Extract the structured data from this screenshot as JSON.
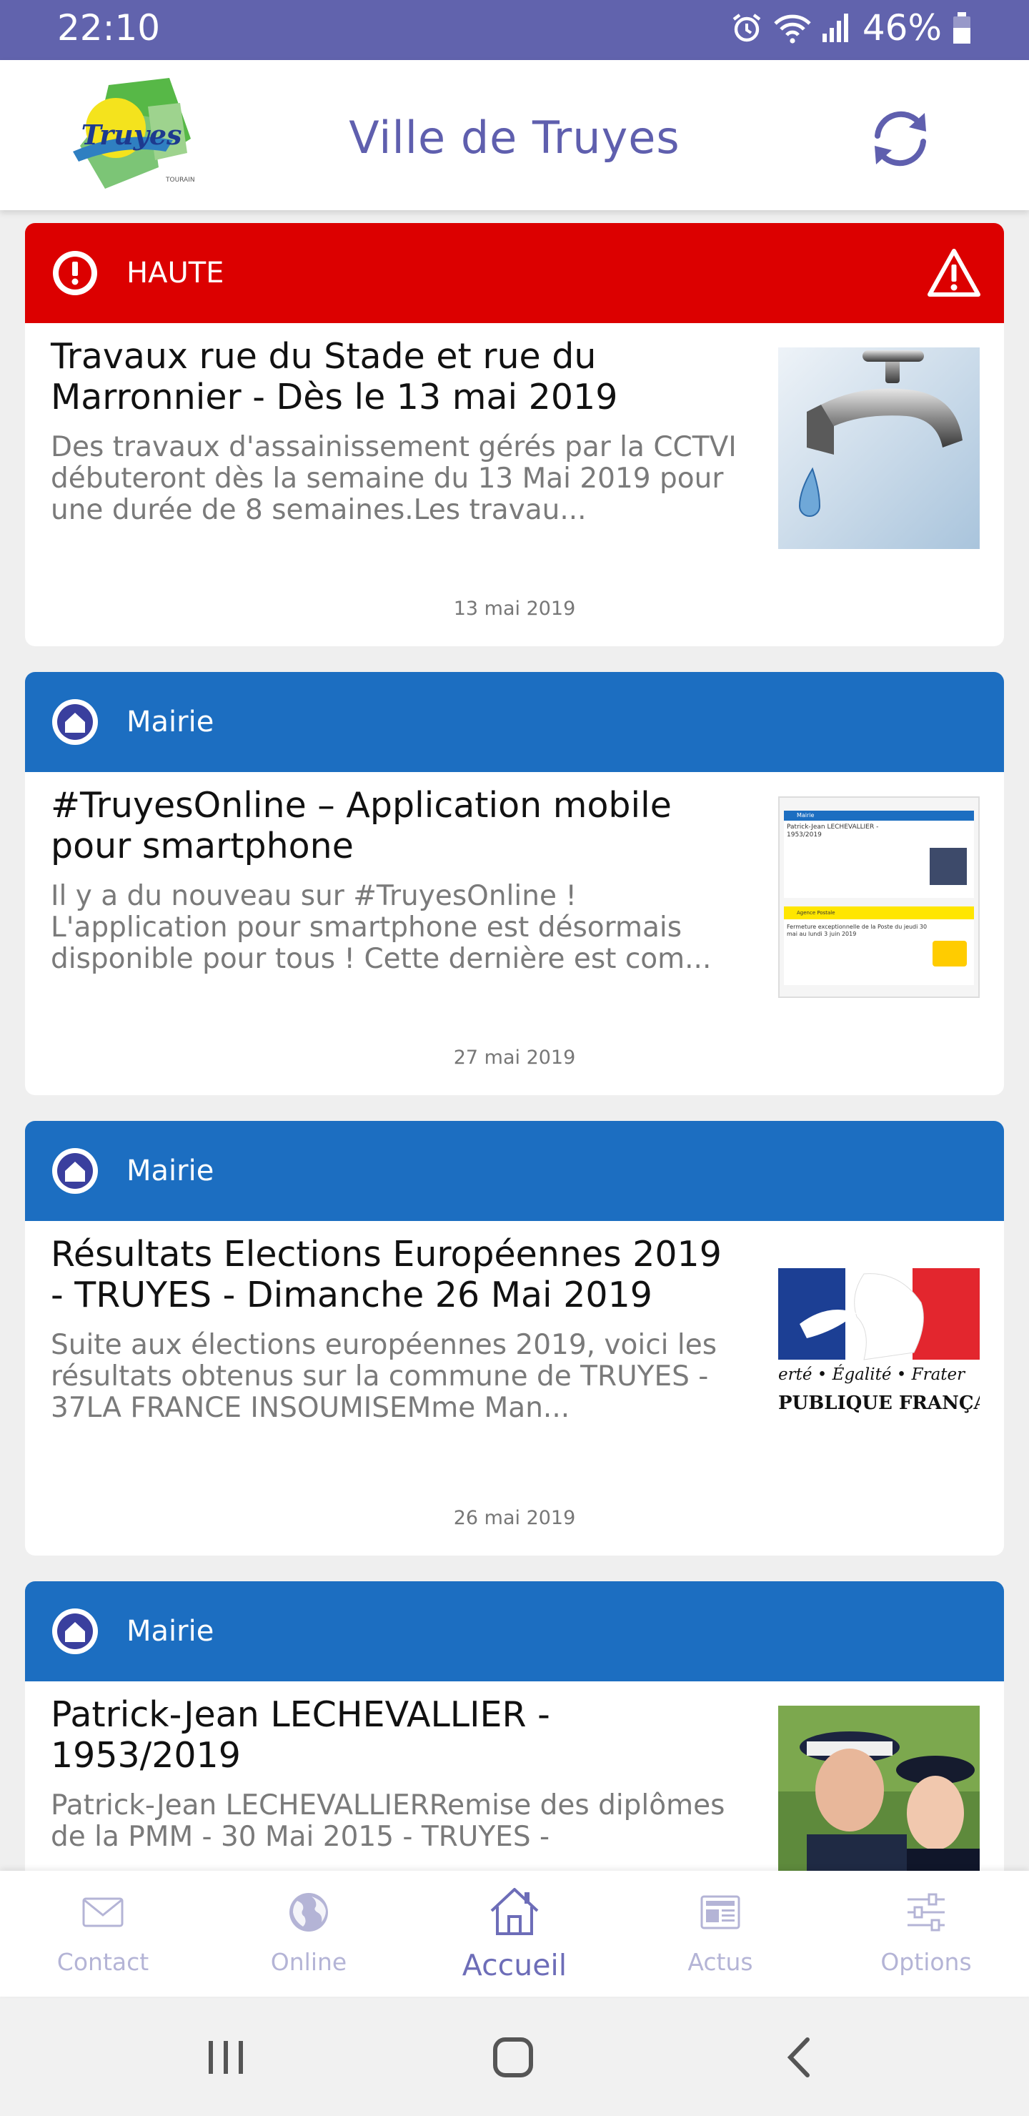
{
  "status_bar": {
    "time": "22:10",
    "battery": "46%"
  },
  "header": {
    "title": "Ville de Truyes",
    "logo_text": "Truyes",
    "logo_subtext": "TOURAINE"
  },
  "colors": {
    "brand": "#6163ad",
    "haute": "#dc0000",
    "mairie": "#1c6ec1"
  },
  "articles": [
    {
      "category": "HAUTE",
      "category_icon": "alert-icon",
      "title": "Travaux rue du Stade et rue du Marronnier - Dès le 13 mai 2019",
      "excerpt": "Des travaux d'assainissement gérés par la CCTVI débuteront dès la semaine du 13 Mai 2019 pour une durée de 8 semaines.Les travau...",
      "date": "13 mai 2019",
      "thumbnail": "water-tap-image"
    },
    {
      "category": "Mairie",
      "category_icon": "home-icon",
      "title": "#TruyesOnline – Application mobile pour smartphone",
      "excerpt": "Il y a du nouveau sur #TruyesOnline ! L'application pour smartphone est désormais disponible pour tous ! Cette dernière est com...",
      "date": "27 mai 2019",
      "thumbnail": "app-screenshot-image",
      "thumb_texts": {
        "mairie_tag": "Mairie",
        "name": "Patrick-Jean LECHEVALLIER - 1953/2019",
        "poste_tag": "Agence Postale",
        "notice": "Fermeture exceptionnelle de la Poste du jeudi 30 mai au lundi 3 juin 2019"
      }
    },
    {
      "category": "Mairie",
      "category_icon": "home-icon",
      "title": "Résultats Elections Européennes 2019 - TRUYES - Dimanche 26 Mai 2019",
      "excerpt": "Suite aux élections européennes 2019, voici les résultats obtenus sur la commune de TRUYES - 37LA FRANCE INSOUMISEMme Man...",
      "date": "26 mai 2019",
      "thumbnail": "republique-francaise-logo",
      "thumb_texts": {
        "motto": "erté • Égalité • Frater",
        "name": "PUBLIQUE FRANÇA"
      }
    },
    {
      "category": "Mairie",
      "category_icon": "home-icon",
      "title": "Patrick-Jean LECHEVALLIER - 1953/2019",
      "excerpt": "Patrick-Jean LECHEVALLIERRemise des diplômes de la PMM - 30 Mai 2015 - TRUYES -",
      "date": "",
      "thumbnail": "navy-officers-photo"
    }
  ],
  "bottom_nav": [
    {
      "label": "Contact",
      "icon": "mail-icon"
    },
    {
      "label": "Online",
      "icon": "globe-icon"
    },
    {
      "label": "Accueil",
      "icon": "home-icon",
      "active": true
    },
    {
      "label": "Actus",
      "icon": "news-icon"
    },
    {
      "label": "Options",
      "icon": "sliders-icon"
    }
  ]
}
